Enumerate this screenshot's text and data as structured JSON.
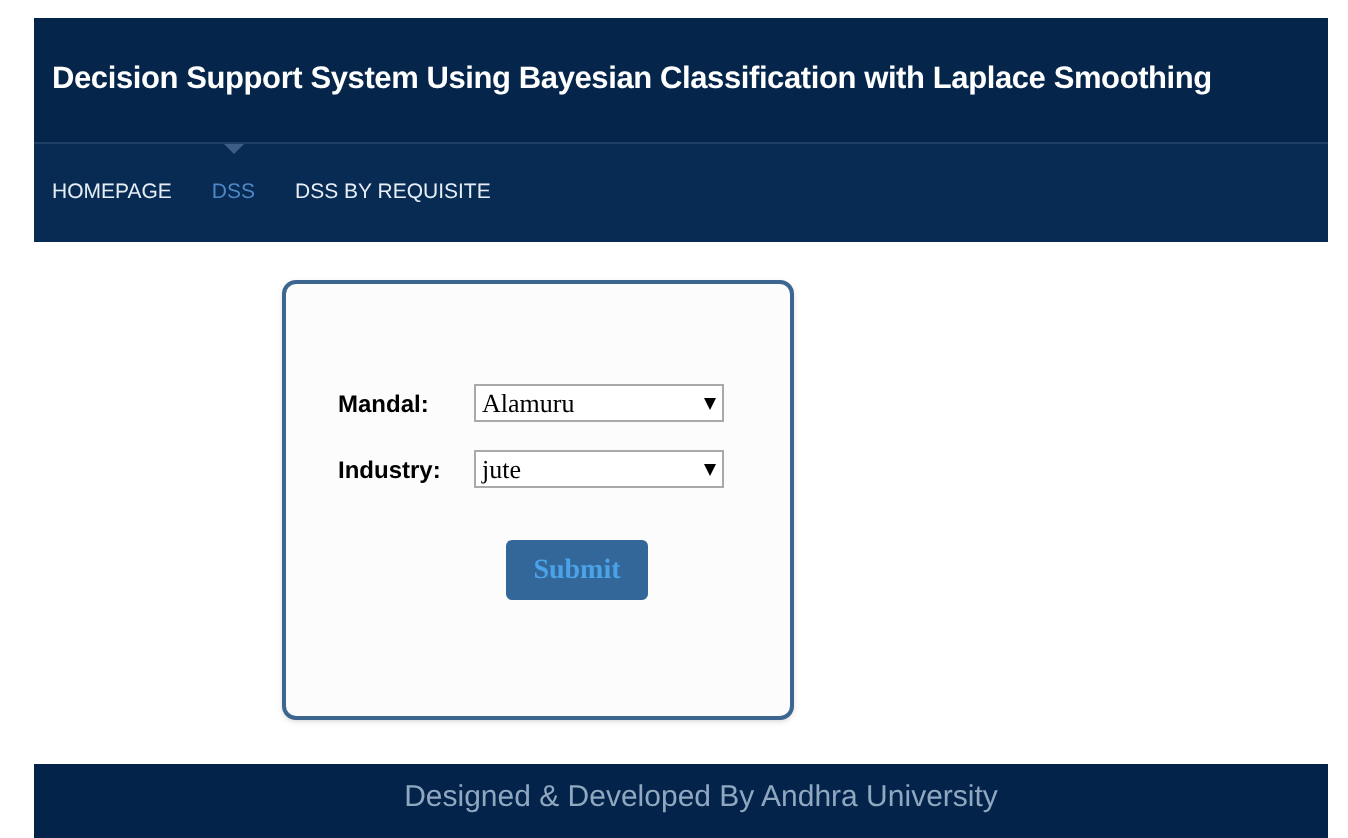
{
  "header": {
    "title": "Decision Support System Using Bayesian Classification with Laplace Smoothing"
  },
  "nav": {
    "items": [
      {
        "label": "HOMEPAGE",
        "selected": false
      },
      {
        "label": "DSS",
        "selected": true
      },
      {
        "label": "DSS BY REQUISITE",
        "selected": false
      }
    ]
  },
  "form": {
    "fields": [
      {
        "label": "Mandal:",
        "value": "Alamuru"
      },
      {
        "label": "Industry:",
        "value": "jute"
      }
    ],
    "submit": "Submit"
  },
  "footer": {
    "text": "Designed & Developed By Andhra University"
  }
}
